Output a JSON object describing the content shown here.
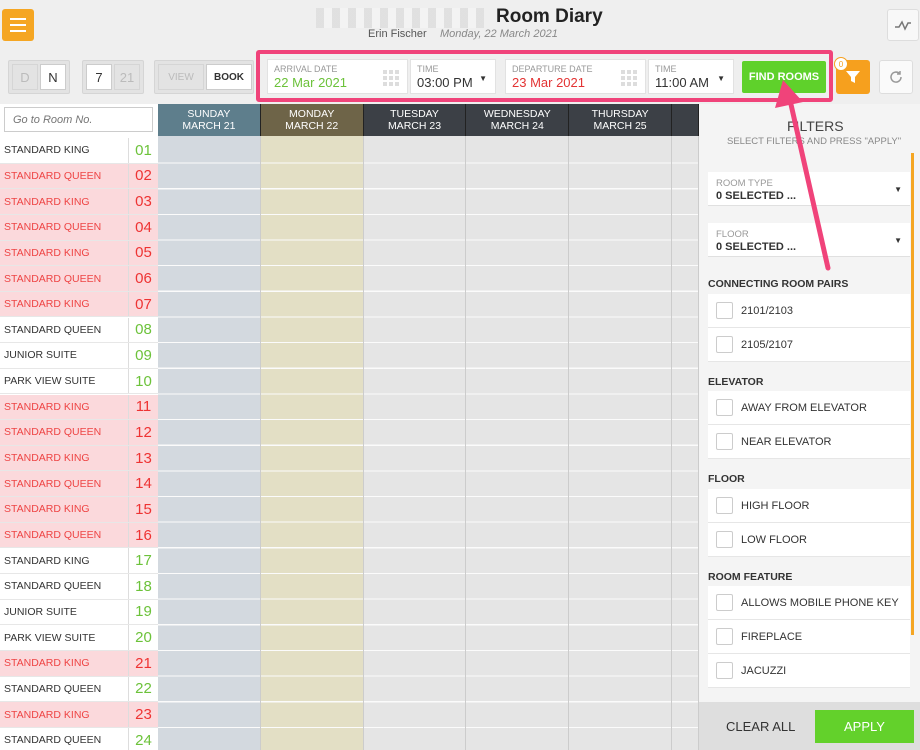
{
  "header": {
    "title": "Room Diary",
    "user": "Erin Fischer",
    "date": "Monday, 22 March 2021"
  },
  "toolbar": {
    "day_toggle": [
      "D",
      "N"
    ],
    "num_toggle": [
      "7",
      "21"
    ],
    "mode_toggle": [
      "VIEW",
      "BOOK"
    ],
    "arrival_label": "ARRIVAL DATE",
    "arrival_value": "22 Mar 2021",
    "arrival_time_label": "TIME",
    "arrival_time_value": "03:00 PM",
    "departure_label": "DEPARTURE DATE",
    "departure_value": "23 Mar 2021",
    "departure_time_label": "TIME",
    "departure_time_value": "11:00 AM",
    "find_rooms": "FIND ROOMS",
    "filter_count": "0"
  },
  "grid": {
    "goto_placeholder": "Go to Room No.",
    "days": [
      {
        "day": "SUNDAY",
        "date": "MARCH 21"
      },
      {
        "day": "MONDAY",
        "date": "MARCH 22"
      },
      {
        "day": "TUESDAY",
        "date": "MARCH 23"
      },
      {
        "day": "WEDNESDAY",
        "date": "MARCH 24"
      },
      {
        "day": "THURSDAY",
        "date": "MARCH 25"
      }
    ],
    "rooms": [
      {
        "type": "STANDARD KING",
        "no": "01",
        "state": "w"
      },
      {
        "type": "STANDARD QUEEN",
        "no": "02",
        "state": "p"
      },
      {
        "type": "STANDARD KING",
        "no": "03",
        "state": "p"
      },
      {
        "type": "STANDARD QUEEN",
        "no": "04",
        "state": "p"
      },
      {
        "type": "STANDARD KING",
        "no": "05",
        "state": "p"
      },
      {
        "type": "STANDARD QUEEN",
        "no": "06",
        "state": "p"
      },
      {
        "type": "STANDARD KING",
        "no": "07",
        "state": "p"
      },
      {
        "type": "STANDARD QUEEN",
        "no": "08",
        "state": "w"
      },
      {
        "type": "JUNIOR SUITE",
        "no": "09",
        "state": "w"
      },
      {
        "type": "PARK VIEW SUITE",
        "no": "10",
        "state": "w"
      },
      {
        "type": "STANDARD KING",
        "no": "11",
        "state": "p"
      },
      {
        "type": "STANDARD QUEEN",
        "no": "12",
        "state": "p"
      },
      {
        "type": "STANDARD KING",
        "no": "13",
        "state": "p"
      },
      {
        "type": "STANDARD QUEEN",
        "no": "14",
        "state": "p"
      },
      {
        "type": "STANDARD KING",
        "no": "15",
        "state": "p"
      },
      {
        "type": "STANDARD QUEEN",
        "no": "16",
        "state": "p"
      },
      {
        "type": "STANDARD KING",
        "no": "17",
        "state": "w"
      },
      {
        "type": "STANDARD QUEEN",
        "no": "18",
        "state": "w"
      },
      {
        "type": "JUNIOR SUITE",
        "no": "19",
        "state": "w"
      },
      {
        "type": "PARK VIEW SUITE",
        "no": "20",
        "state": "w"
      },
      {
        "type": "STANDARD KING",
        "no": "21",
        "state": "p"
      },
      {
        "type": "STANDARD QUEEN",
        "no": "22",
        "state": "w"
      },
      {
        "type": "STANDARD KING",
        "no": "23",
        "state": "p"
      },
      {
        "type": "STANDARD QUEEN",
        "no": "24",
        "state": "w"
      }
    ]
  },
  "filters": {
    "title": "FILTERS",
    "subtitle": "SELECT FILTERS AND PRESS \"APPLY\"",
    "room_type_label": "ROOM TYPE",
    "room_type_value": "0 SELECTED ...",
    "floor_label": "FLOOR",
    "floor_value": "0 SELECTED ...",
    "connecting_title": "CONNECTING ROOM PAIRS",
    "connecting": [
      "2101/2103",
      "2105/2107"
    ],
    "elevator_title": "ELEVATOR",
    "elevator": [
      "AWAY FROM ELEVATOR",
      "NEAR ELEVATOR"
    ],
    "floor_title": "FLOOR",
    "floor_opts": [
      "HIGH FLOOR",
      "LOW FLOOR"
    ],
    "feature_title": "ROOM FEATURE",
    "features": [
      "ALLOWS MOBILE PHONE KEY",
      "FIREPLACE",
      "JACUZZI"
    ],
    "clear_all": "CLEAR ALL",
    "apply": "APPLY"
  },
  "colors": {
    "accent": "#f5a623",
    "find_green": "#5fd12b",
    "highlight": "#f0437a",
    "arrival_green": "#6cc23a",
    "departure_red": "#e33333"
  }
}
